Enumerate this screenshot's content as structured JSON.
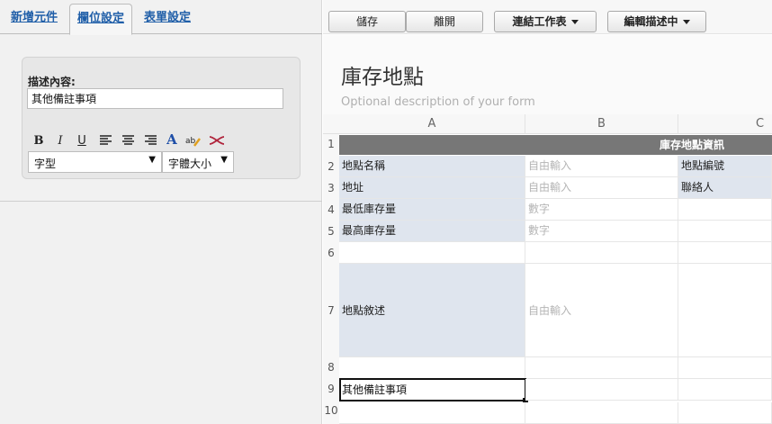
{
  "left_panel": {
    "tabs": [
      {
        "label": "新增元件"
      },
      {
        "label": "欄位設定"
      },
      {
        "label": "表單設定"
      }
    ],
    "field_settings": {
      "description_label": "描述內容:",
      "description_value": "其他備註事項",
      "font_select": "字型",
      "size_select": "字體大小"
    }
  },
  "toolbar": {
    "save": "儲存",
    "exit": "離開",
    "link_sheet": "連結工作表",
    "editing_desc": "編輯描述中"
  },
  "form": {
    "title": "庫存地點",
    "description_placeholder": "Optional description of your form"
  },
  "grid": {
    "columns": [
      "A",
      "B",
      "C"
    ],
    "rows": [
      "1",
      "2",
      "3",
      "4",
      "5",
      "6",
      "7",
      "8",
      "9",
      "10"
    ],
    "header_band": "庫存地點資訊",
    "cells": {
      "a2": "地點名稱",
      "b2": "自由輸入",
      "c2": "地點編號",
      "a3": "地址",
      "b3": "自由輸入",
      "c3": "聯絡人",
      "a4": "最低庫存量",
      "b4": "數字",
      "a5": "最高庫存量",
      "b5": "數字",
      "a7": "地點敘述",
      "b7": "自由輸入",
      "a9": "其他備註事項"
    }
  }
}
